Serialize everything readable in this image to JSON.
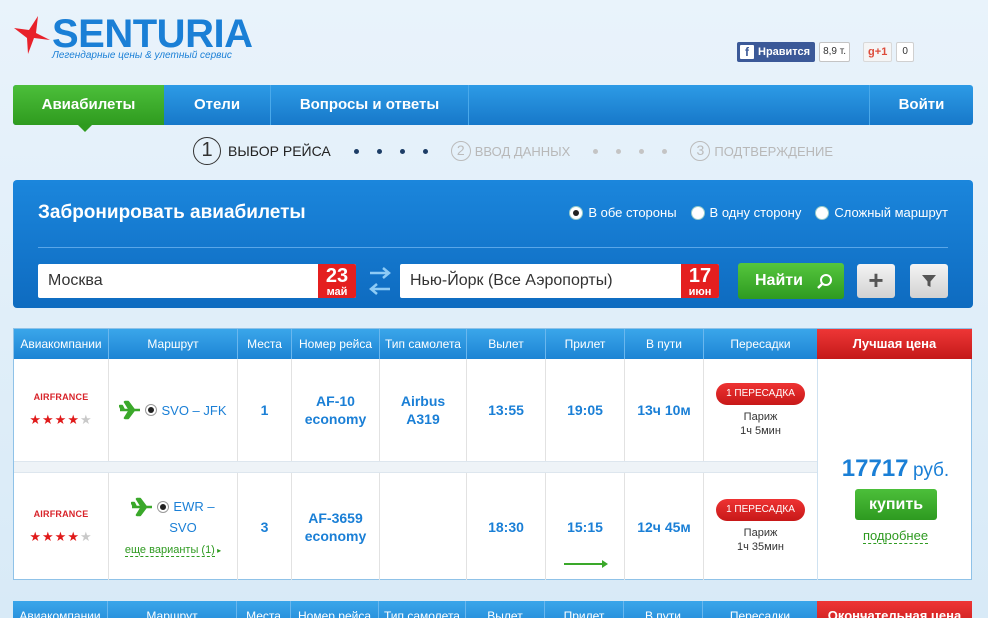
{
  "brand": {
    "name": "SENTURIA",
    "tagline": "Легендарные цены & улетный сервис",
    "star_color": "#e8212a",
    "text_color": "#1a7fd6"
  },
  "social": {
    "fb_label": "Нравится",
    "fb_count": "8,9 т.",
    "gplus_label": "+1",
    "gplus_count": "0"
  },
  "nav": {
    "items": [
      "Авиабилеты",
      "Отели",
      "Вопросы и ответы"
    ],
    "login": "Войти"
  },
  "steps": [
    {
      "num": "1",
      "label": "ВЫБОР РЕЙСА"
    },
    {
      "num": "2",
      "label": "ВВОД ДАННЫХ"
    },
    {
      "num": "3",
      "label": "ПОДТВЕРЖДЕНИЕ"
    }
  ],
  "booking": {
    "title": "Забронировать авиабилеты",
    "radios": [
      "В обе стороны",
      "В одну сторону",
      "Сложный маршрут"
    ],
    "selected_radio": "В обе стороны",
    "from": {
      "city": "Москва",
      "day": "23",
      "month": "май"
    },
    "to": {
      "city": "Нью-Йорк (Все Аэропорты)",
      "day": "17",
      "month": "июн"
    },
    "find_label": "Найти",
    "plus_label": "+"
  },
  "table": {
    "headers": [
      "Авиакомпании",
      "Маршрут",
      "Места",
      "Номер рейса",
      "Тип самолета",
      "Вылет",
      "Прилет",
      "В пути",
      "Пересадки"
    ],
    "best_price_label": "Лучшая цена",
    "next_best_label": "Окончательная цена",
    "rows": [
      {
        "airline": "AIRFRANCE",
        "rating": 4,
        "route": "SVO – JFK",
        "seats": "1",
        "flight_no": "AF-10",
        "flight_class": "economy",
        "aircraft_line1": "Airbus",
        "aircraft_line2": "A319",
        "departure": "13:55",
        "arrival": "19:05",
        "duration": "13ч 10м",
        "transfer_badge": "1 ПЕРЕСАДКА",
        "transfer_city": "Париж",
        "transfer_time": "1ч 5мин"
      },
      {
        "airline": "AIRFRANCE",
        "rating": 4,
        "route_line1": "EWR –",
        "route_line2": "SVO",
        "more_variants": "еще варианты (1)",
        "seats": "3",
        "flight_no": "AF-3659",
        "flight_class": "economy",
        "departure": "18:30",
        "arrival": "15:15",
        "duration": "12ч 45м",
        "transfer_badge": "1 ПЕРЕСАДКА",
        "transfer_city": "Париж",
        "transfer_time": "1ч 35мин"
      }
    ],
    "price": "17717",
    "currency": "руб.",
    "buy_label": "купить",
    "details_label": "подробнее"
  }
}
